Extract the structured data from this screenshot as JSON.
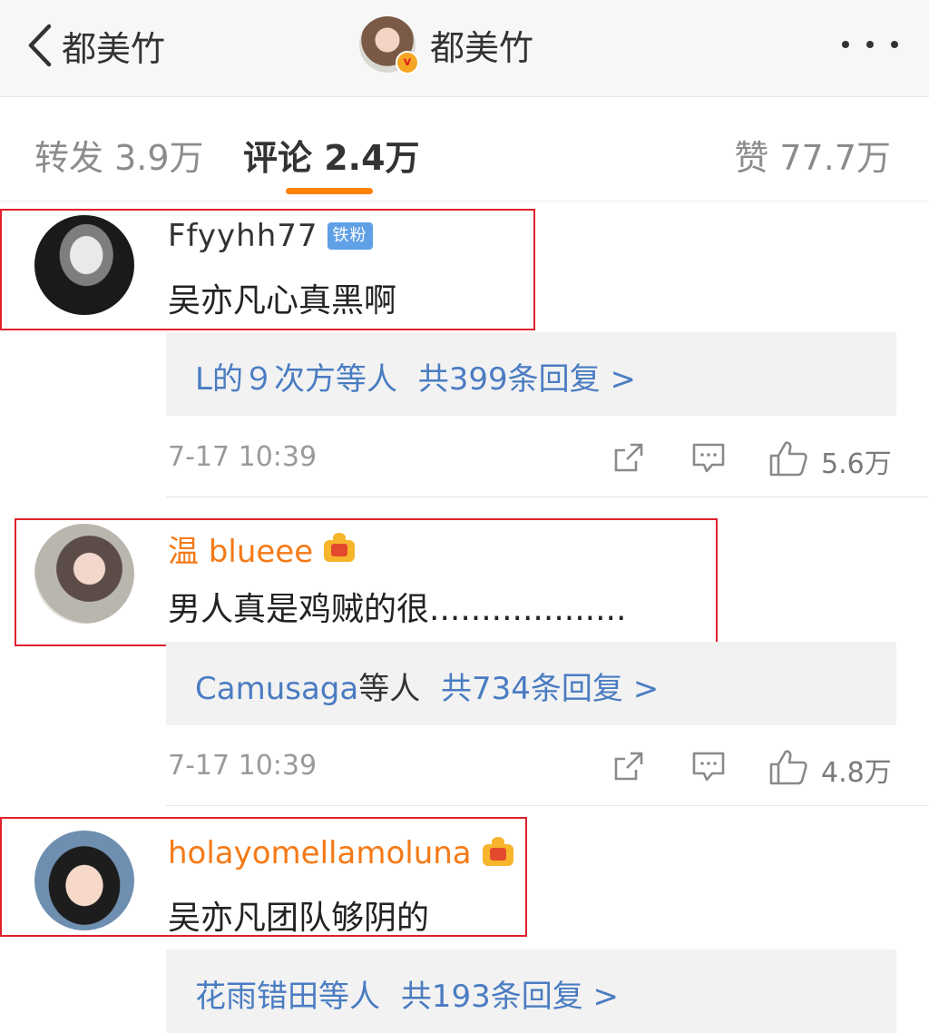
{
  "header": {
    "back_title": "都美竹",
    "center_name": "都美竹",
    "verified_badge": "v"
  },
  "tabs": {
    "repost": "转发 3.9万",
    "comments": "评论 2.4万",
    "likes": "赞 77.7万"
  },
  "accent_color": "#ff8200",
  "comments": [
    {
      "username": "Ffyyhh77",
      "badge": "铁粉",
      "text": "吴亦凡心真黑啊",
      "reply_users": "L的９次方等人",
      "reply_count": "共399条回复 >",
      "time": "7-17 10:39",
      "likes": "5.6万"
    },
    {
      "username": "温 blueee",
      "text": "男人真是鸡贼的很...................",
      "reply_users": "Camusaga",
      "reply_others": "等人",
      "reply_count": "共734条回复 >",
      "time": "7-17 10:39",
      "likes": "4.8万"
    },
    {
      "username": "holayomellamoluna",
      "text": "吴亦凡团队够阴的",
      "reply_users": "花雨错田等人",
      "reply_count": "共193条回复 >"
    }
  ]
}
